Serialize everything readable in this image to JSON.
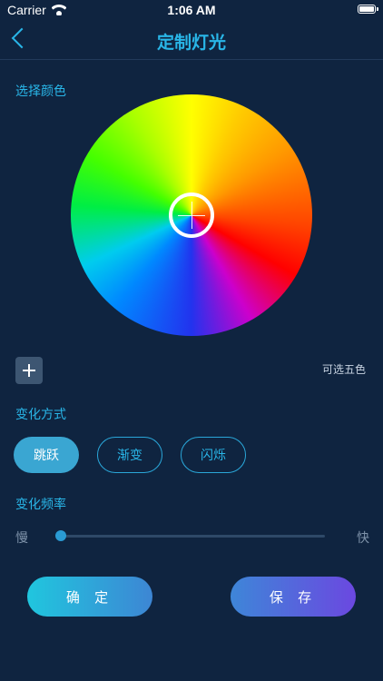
{
  "status_bar": {
    "carrier": "Carrier",
    "time": "1:06 AM"
  },
  "nav": {
    "title": "定制灯光"
  },
  "color_section": {
    "label": "选择颜色",
    "hint": "可选五色"
  },
  "mode_section": {
    "label": "变化方式",
    "options": [
      "跳跃",
      "渐变",
      "闪烁"
    ],
    "selected": "跳跃"
  },
  "frequency_section": {
    "label": "变化频率",
    "slow_label": "慢",
    "fast_label": "快",
    "value_fraction": 0.0
  },
  "actions": {
    "confirm_label": "确 定",
    "save_label": "保 存"
  },
  "colors": {
    "background": "#0f2440",
    "accent": "#29b6e8"
  }
}
